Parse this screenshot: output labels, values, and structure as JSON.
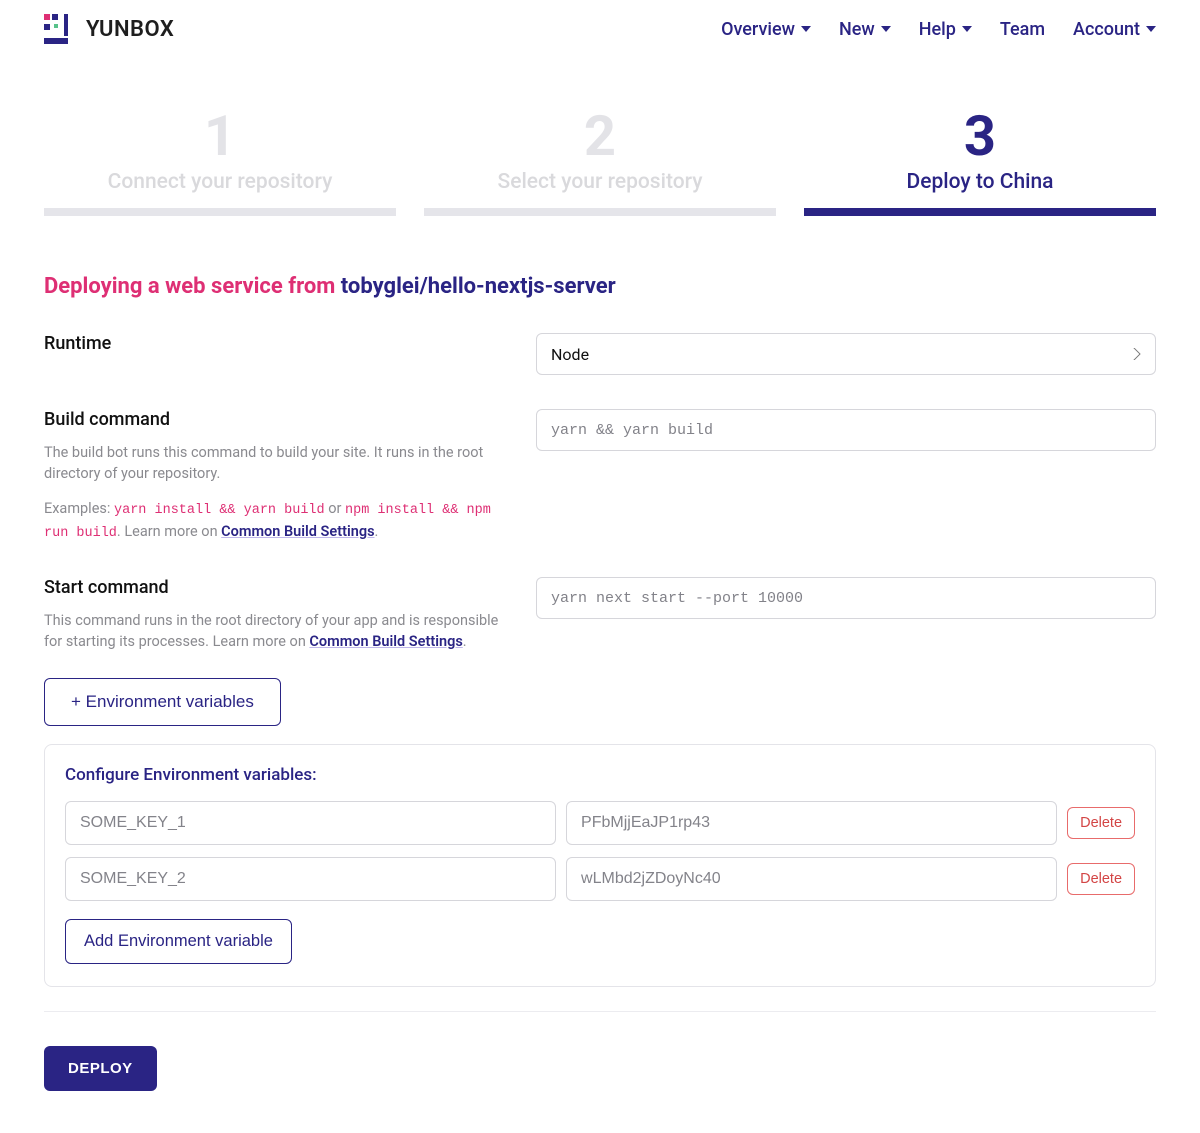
{
  "brand": {
    "name": "YUNBOX"
  },
  "nav": {
    "overview": "Overview",
    "new": "New",
    "help": "Help",
    "team": "Team",
    "account": "Account"
  },
  "steps": [
    {
      "num": "1",
      "label": "Connect your repository",
      "active": false
    },
    {
      "num": "2",
      "label": "Select your repository",
      "active": false
    },
    {
      "num": "3",
      "label": "Deploy to China",
      "active": true
    }
  ],
  "heading": {
    "prefix": "Deploying a web service from ",
    "repo": "tobyglei/hello-nextjs-server"
  },
  "runtime": {
    "label": "Runtime",
    "value": "Node"
  },
  "build": {
    "label": "Build command",
    "value": "yarn && yarn build",
    "help1": "The build bot runs this command to build your site. It runs in the root directory of your repository.",
    "examples_prefix": "Examples: ",
    "ex1": "yarn install && yarn build",
    "or": " or ",
    "ex2": "npm install && npm run build",
    "learn_prefix": ". Learn more on ",
    "link": "Common Build Settings",
    "period": "."
  },
  "start": {
    "label": "Start command",
    "value": "yarn next start --port 10000",
    "help_prefix": "This command runs in the root directory of your app and is responsible for starting its processes. Learn more on ",
    "link": "Common Build Settings",
    "period": "."
  },
  "env_toggle_label": "+ Environment variables",
  "env_panel": {
    "title": "Configure Environment variables:",
    "rows": [
      {
        "key": "SOME_KEY_1",
        "value": "PFbMjjEaJP1rp43"
      },
      {
        "key": "SOME_KEY_2",
        "value": "wLMbd2jZDoyNc40"
      }
    ],
    "delete_label": "Delete",
    "add_label": "Add Environment variable"
  },
  "deploy_label": "DEPLOY"
}
